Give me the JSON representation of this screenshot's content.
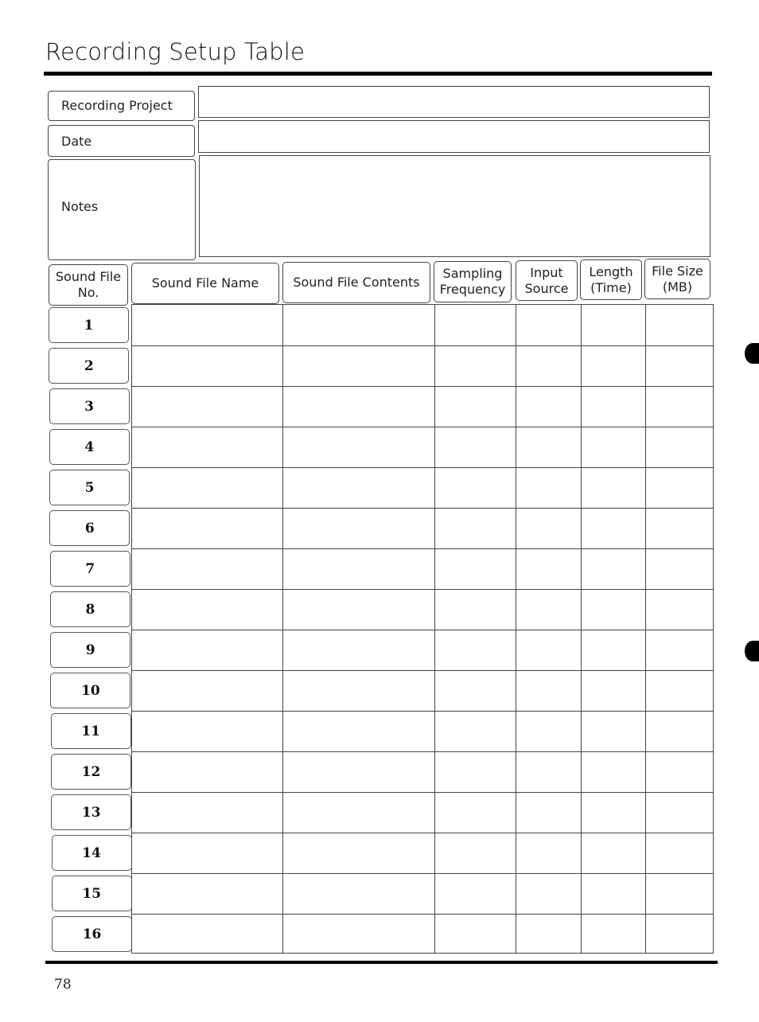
{
  "page": {
    "title": "Recording Setup Table",
    "page_number": "78"
  },
  "info_fields": [
    {
      "label": "Recording Project",
      "value": ""
    },
    {
      "label": "Date",
      "value": ""
    },
    {
      "label": "Notes",
      "value": ""
    }
  ],
  "table": {
    "columns": [
      {
        "line1": "Sound File",
        "line2": "No."
      },
      {
        "line1": "Sound File Name",
        "line2": ""
      },
      {
        "line1": "Sound File Contents",
        "line2": ""
      },
      {
        "line1": "Sampling",
        "line2": "Frequency"
      },
      {
        "line1": "Input",
        "line2": "Source"
      },
      {
        "line1": "Length",
        "line2": "(Time)"
      },
      {
        "line1": "File Size",
        "line2": "(MB)"
      }
    ],
    "rows": [
      {
        "no": "1",
        "name": "",
        "contents": "",
        "sampling_frequency": "",
        "input_source": "",
        "length": "",
        "file_size": ""
      },
      {
        "no": "2",
        "name": "",
        "contents": "",
        "sampling_frequency": "",
        "input_source": "",
        "length": "",
        "file_size": ""
      },
      {
        "no": "3",
        "name": "",
        "contents": "",
        "sampling_frequency": "",
        "input_source": "",
        "length": "",
        "file_size": ""
      },
      {
        "no": "4",
        "name": "",
        "contents": "",
        "sampling_frequency": "",
        "input_source": "",
        "length": "",
        "file_size": ""
      },
      {
        "no": "5",
        "name": "",
        "contents": "",
        "sampling_frequency": "",
        "input_source": "",
        "length": "",
        "file_size": ""
      },
      {
        "no": "6",
        "name": "",
        "contents": "",
        "sampling_frequency": "",
        "input_source": "",
        "length": "",
        "file_size": ""
      },
      {
        "no": "7",
        "name": "",
        "contents": "",
        "sampling_frequency": "",
        "input_source": "",
        "length": "",
        "file_size": ""
      },
      {
        "no": "8",
        "name": "",
        "contents": "",
        "sampling_frequency": "",
        "input_source": "",
        "length": "",
        "file_size": ""
      },
      {
        "no": "9",
        "name": "",
        "contents": "",
        "sampling_frequency": "",
        "input_source": "",
        "length": "",
        "file_size": ""
      },
      {
        "no": "10",
        "name": "",
        "contents": "",
        "sampling_frequency": "",
        "input_source": "",
        "length": "",
        "file_size": ""
      },
      {
        "no": "11",
        "name": "",
        "contents": "",
        "sampling_frequency": "",
        "input_source": "",
        "length": "",
        "file_size": ""
      },
      {
        "no": "12",
        "name": "",
        "contents": "",
        "sampling_frequency": "",
        "input_source": "",
        "length": "",
        "file_size": ""
      },
      {
        "no": "13",
        "name": "",
        "contents": "",
        "sampling_frequency": "",
        "input_source": "",
        "length": "",
        "file_size": ""
      },
      {
        "no": "14",
        "name": "",
        "contents": "",
        "sampling_frequency": "",
        "input_source": "",
        "length": "",
        "file_size": ""
      },
      {
        "no": "15",
        "name": "",
        "contents": "",
        "sampling_frequency": "",
        "input_source": "",
        "length": "",
        "file_size": ""
      },
      {
        "no": "16",
        "name": "",
        "contents": "",
        "sampling_frequency": "",
        "input_source": "",
        "length": "",
        "file_size": ""
      }
    ]
  }
}
